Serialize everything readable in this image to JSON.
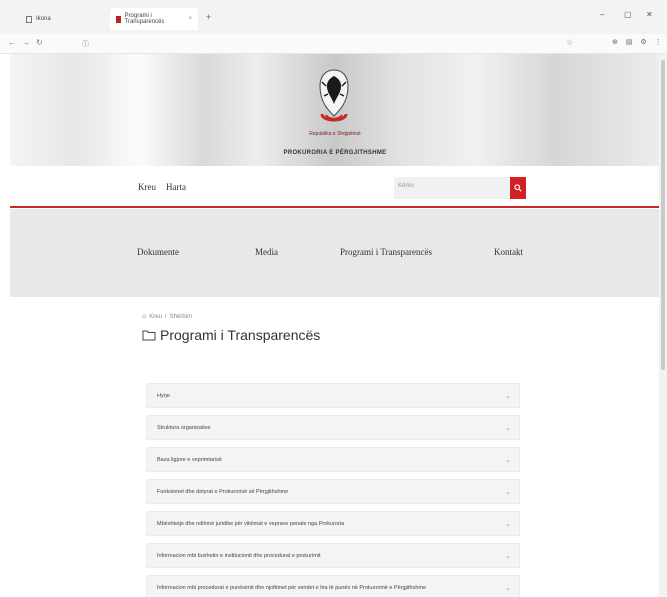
{
  "browser": {
    "tab1": "Ikona",
    "tab2": "Programi i Transparencës",
    "tab_close": "×",
    "new_tab": "+",
    "url_prefix": "",
    "url_domain": "",
    "url_path": ""
  },
  "header": {
    "emblem_subtitle": "Republika e Shqipërisë",
    "emblem_title": "PROKURORIA E PËRGJITHSHME"
  },
  "topnav": {
    "links": [
      "Kreu",
      "Harta"
    ],
    "search_placeholder": "Kërko"
  },
  "menu": {
    "items": [
      "Dokumente",
      "Media",
      "Programi i Transparencës",
      "Kontakt"
    ]
  },
  "breadcrumb": {
    "home": "Kreu",
    "sep": "/",
    "current": "Shërbim"
  },
  "page": {
    "title": "Programi i Transparencës"
  },
  "accordion": {
    "items": [
      "Hyrje",
      "Struktura organizative",
      "Baza ligjore e veprimtarisë",
      "Funksionet dhe detyrat e Prokurorisë së Përgjithshme",
      "Mbështetje dhe ndihmë juridike për viktimat e veprave penale nga Prokuroria",
      "Informacion mbi buxhetin e institucionit dhe procedurat e prokurimit",
      "Informacion mbi procedurat e punësimit dhe njoftimet për vendet e lira të punës në Prokurorinë e Përgjithshme"
    ]
  },
  "colors": {
    "accent": "#c62828",
    "search_button": "#d32027"
  }
}
